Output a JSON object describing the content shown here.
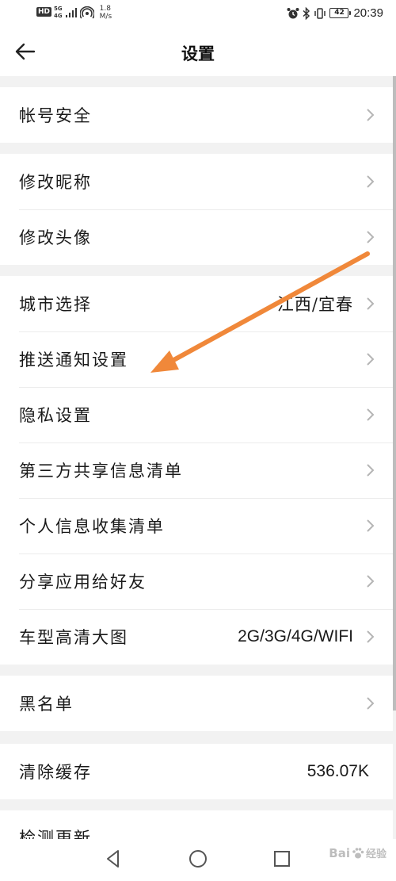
{
  "status_bar": {
    "hd": "HD",
    "network_type": "5G",
    "signal_sub": "4G",
    "speed_value": "1.8",
    "speed_unit": "M/s",
    "battery_level": "42",
    "time": "20:39",
    "icons": [
      "hd-icon",
      "signal-icon",
      "wifi-hotspot-icon",
      "alarm-icon",
      "bluetooth-icon",
      "vibrate-icon",
      "battery-icon"
    ]
  },
  "header": {
    "back_icon": "arrow-left-icon",
    "title": "设置"
  },
  "sections": [
    {
      "items": [
        {
          "label": "帐号安全",
          "value": ""
        }
      ]
    },
    {
      "items": [
        {
          "label": "修改昵称",
          "value": ""
        },
        {
          "label": "修改头像",
          "value": ""
        }
      ]
    },
    {
      "items": [
        {
          "label": "城市选择",
          "value": "江西/宜春"
        },
        {
          "label": "推送通知设置",
          "value": ""
        },
        {
          "label": "隐私设置",
          "value": ""
        },
        {
          "label": "第三方共享信息清单",
          "value": ""
        },
        {
          "label": "个人信息收集清单",
          "value": ""
        },
        {
          "label": "分享应用给好友",
          "value": ""
        },
        {
          "label": "车型高清大图",
          "value": "2G/3G/4G/WIFI"
        }
      ]
    },
    {
      "items": [
        {
          "label": "黑名单",
          "value": ""
        }
      ]
    },
    {
      "items": [
        {
          "label": "清除缓存",
          "value": "536.07K"
        }
      ]
    },
    {
      "items": [
        {
          "label": "检测更新",
          "value": ""
        }
      ]
    }
  ],
  "annotation": {
    "arrow_color": "#f0883a",
    "points_to": "推送通知设置"
  },
  "nav_bar": {
    "icons": [
      "nav-back-icon",
      "nav-home-icon",
      "nav-recent-icon"
    ]
  },
  "watermark": {
    "text": "Bai",
    "suffix": "经验"
  }
}
